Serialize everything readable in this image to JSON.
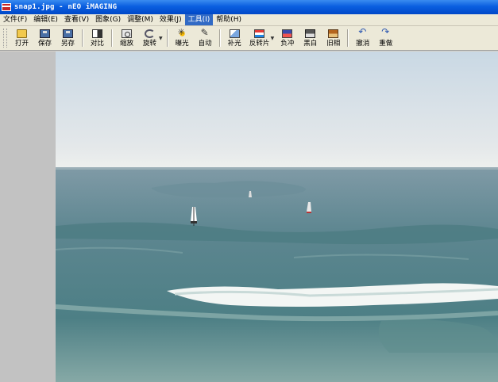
{
  "window": {
    "title": "snap1.jpg - nEO iMAGING"
  },
  "menu": [
    {
      "label": "文件(F)"
    },
    {
      "label": "编辑(E)"
    },
    {
      "label": "查看(V)"
    },
    {
      "label": "图象(G)"
    },
    {
      "label": "调整(M)"
    },
    {
      "label": "效果(J)"
    },
    {
      "label": "工具(I)",
      "active": true
    },
    {
      "label": "帮助(H)"
    }
  ],
  "toolbar": {
    "open": "打开",
    "save": "保存",
    "save_as": "另存",
    "contrast": "对比",
    "zoom": "缩放",
    "rotate": "旋转",
    "exposure": "曝光",
    "auto": "自动",
    "fill_light": "补光",
    "invert": "反转片",
    "negative": "负冲",
    "bw": "黑白",
    "sepia": "旧相",
    "undo": "撤消",
    "redo": "重做"
  },
  "icons": {
    "open": "folder-icon",
    "save": "disk-icon",
    "save_as": "disk-icon",
    "contrast": "contrast-icon",
    "zoom": "zoom-icon",
    "rotate": "rotate-icon",
    "exposure": "sun-icon",
    "auto": "wand-icon",
    "fill_light": "fill-light-icon",
    "invert": "invert-icon",
    "negative": "negative-icon",
    "bw": "bw-icon",
    "sepia": "sepia-icon",
    "undo": "undo-icon",
    "redo": "redo-icon"
  },
  "colors": {
    "titlebar": "#0a5fe0",
    "menu_active": "#316ac5",
    "workspace": "#c2c2c2"
  }
}
